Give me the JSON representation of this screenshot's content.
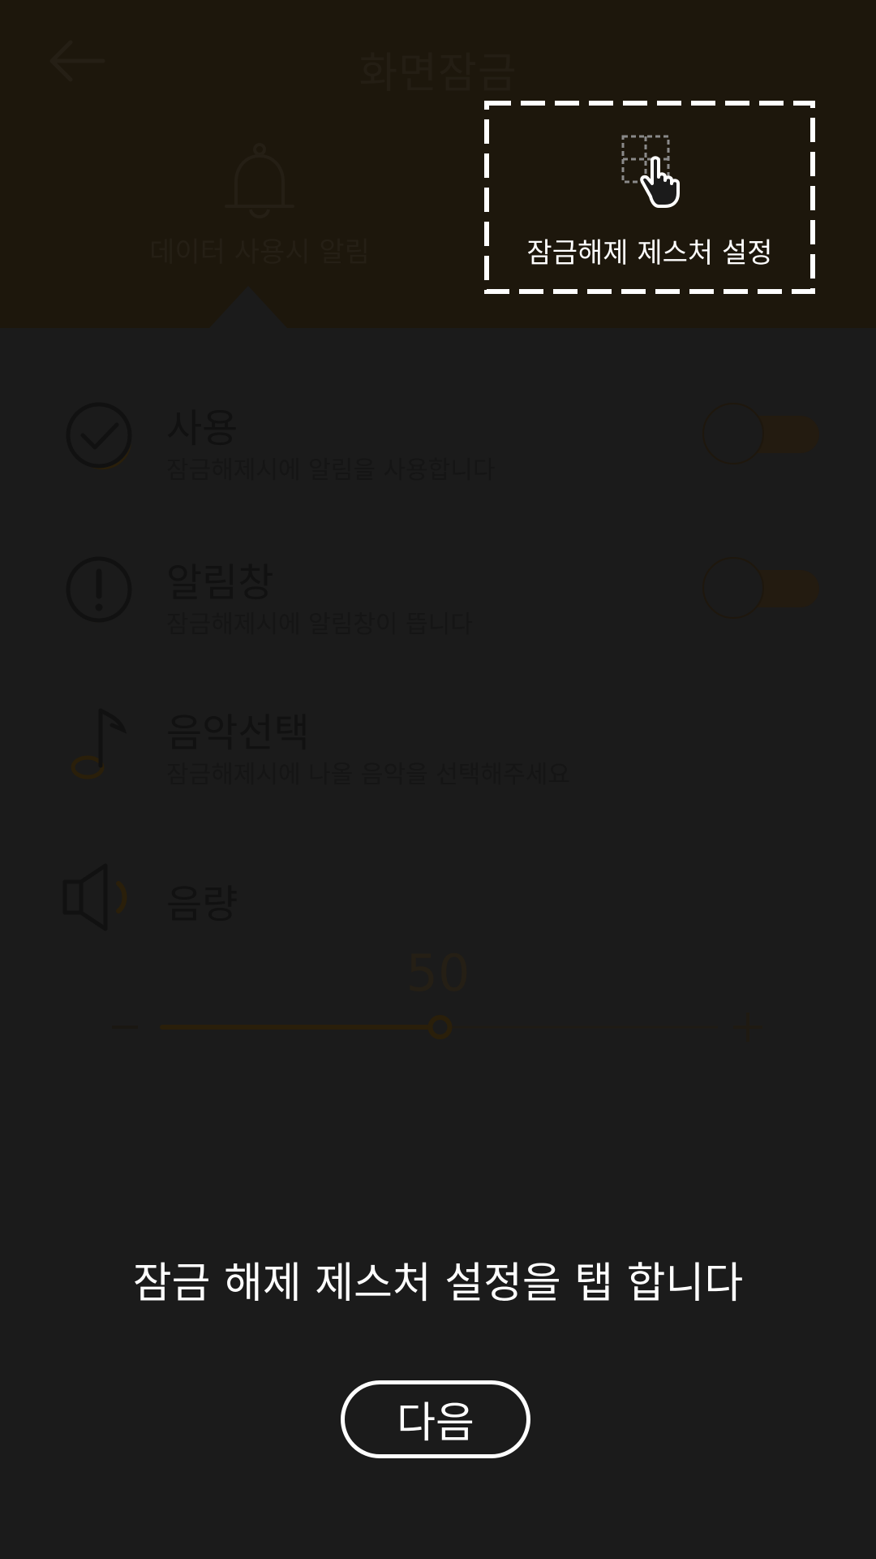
{
  "header": {
    "title": "화면잠금",
    "back_icon": "arrow-left-icon",
    "tabs": [
      {
        "label": "데이터 사용시 알림",
        "icon": "bell-icon"
      },
      {
        "label": "잠금해제 제스처 설정",
        "icon": "gesture-tap-icon"
      }
    ]
  },
  "settings": {
    "items": [
      {
        "title": "사용",
        "description": "잠금해제시에 알림을 사용합니다",
        "icon": "check-circle-icon",
        "toggle_on": false
      },
      {
        "title": "알림창",
        "description": "잠금해제시에 알림창이 뜹니다",
        "icon": "alert-circle-icon",
        "toggle_on": false
      },
      {
        "title": "음악선택",
        "description": "잠금해제시에 나올 음악을 선택해주세요",
        "icon": "music-note-icon"
      },
      {
        "title": "음량",
        "icon": "speaker-icon"
      }
    ],
    "volume": {
      "value": "50",
      "level": 0.5,
      "min_icon": "minus-icon",
      "max_icon": "plus-icon"
    }
  },
  "overlay": {
    "instruction": "잠금 해제 제스처 설정을 탭 합니다",
    "next_label": "다음"
  },
  "colors": {
    "accent": "#f0a81e",
    "dim_overlay": "#1b1b1b",
    "header_dimmed": "#1d170c",
    "highlight": "#ffffff"
  }
}
